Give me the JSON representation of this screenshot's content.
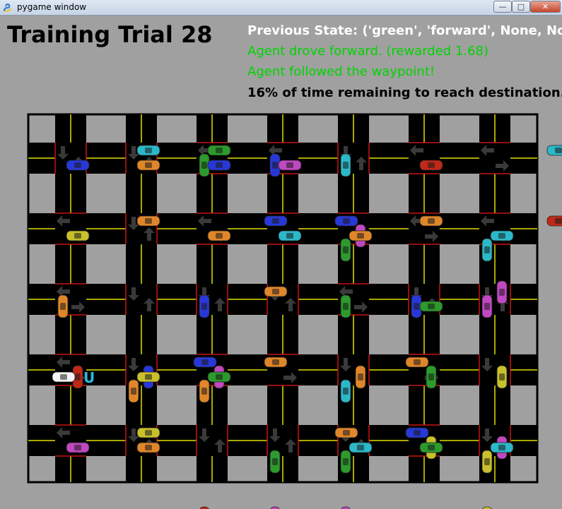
{
  "window": {
    "title": "pygame window",
    "controls": {
      "minimize": "—",
      "maximize": "□",
      "close": "✕"
    },
    "icon": "pygame-snake-icon"
  },
  "hud": {
    "title": "Training Trial 28",
    "previous_state": "Previous State: ('green', 'forward', None, None",
    "action_result": "Agent drove forward. (rewarded 1.68)",
    "waypoint_status": "Agent followed the waypoint!",
    "time_remaining": "16% of time remaining to reach destination."
  },
  "colors": {
    "background": "#a0a0a0",
    "road": "#000000",
    "lane_line": "#e0e000",
    "signal_red": "#c81414",
    "signal_green": "#00c800",
    "text_green": "#00d400",
    "text_white": "#ffffff"
  },
  "grid": {
    "columns": 7,
    "rows": 5,
    "lights": [
      "ns",
      "ns",
      "ew",
      "ew",
      "ns",
      "ew",
      "ew",
      "ew",
      "ns",
      "ew",
      "ew",
      "ew",
      "ew",
      "ew",
      "ew",
      "ns",
      "ns",
      "ns",
      "ew",
      "ns",
      "ns",
      "ew",
      "ns",
      "ew",
      "ew",
      "ns",
      "ew",
      "ns",
      "ew",
      "ns",
      "ns",
      "ns",
      "ns",
      "ew",
      "ns"
    ]
  },
  "cars": [
    {
      "color": "green",
      "dir": "v",
      "col": 2,
      "row": -0.4
    },
    {
      "color": "blue",
      "dir": "v",
      "col": 3,
      "row": -0.4
    },
    {
      "color": "cyan",
      "dir": "v",
      "col": 4,
      "row": -0.4
    },
    {
      "color": "cyan",
      "dir": "h",
      "row": 0,
      "col": 0.6
    },
    {
      "color": "green",
      "dir": "h",
      "row": 0,
      "col": 1.6
    },
    {
      "color": "blue",
      "dir": "h",
      "row": 0.2,
      "col": -0.4
    },
    {
      "color": "orange",
      "dir": "h",
      "row": 0.2,
      "col": 0.6
    },
    {
      "color": "blue",
      "dir": "h",
      "row": 0.2,
      "col": 1.6
    },
    {
      "color": "magenta",
      "dir": "h",
      "row": 0.2,
      "col": 2.6
    },
    {
      "color": "red",
      "dir": "h",
      "row": 0.2,
      "col": 4.6
    },
    {
      "color": "cyan",
      "dir": "h",
      "row": 0,
      "col": 6.4
    },
    {
      "color": "magenta",
      "dir": "v",
      "col": 4.2,
      "row": 0.6
    },
    {
      "color": "green",
      "dir": "v",
      "col": 4,
      "row": 0.8
    },
    {
      "color": "cyan",
      "dir": "v",
      "col": 6,
      "row": 0.8
    },
    {
      "color": "orange",
      "dir": "h",
      "row": 1,
      "col": 0.6
    },
    {
      "color": "blue",
      "dir": "h",
      "row": 1,
      "col": 2.4
    },
    {
      "color": "blue",
      "dir": "h",
      "row": 1,
      "col": 3.4
    },
    {
      "color": "orange",
      "dir": "h",
      "row": 1,
      "col": 4.6
    },
    {
      "color": "red",
      "dir": "h",
      "row": 1,
      "col": 6.4
    },
    {
      "color": "yellow",
      "dir": "h",
      "row": 1.2,
      "col": -0.4
    },
    {
      "color": "orange",
      "dir": "h",
      "row": 1.2,
      "col": 1.6
    },
    {
      "color": "cyan",
      "dir": "h",
      "row": 1.2,
      "col": 2.6
    },
    {
      "color": "orange",
      "dir": "h",
      "row": 1.2,
      "col": 3.6
    },
    {
      "color": "cyan",
      "dir": "h",
      "row": 1.2,
      "col": 5.6
    },
    {
      "color": "orange",
      "dir": "v",
      "col": 0,
      "row": 1.6
    },
    {
      "color": "blue",
      "dir": "v",
      "col": 2,
      "row": 1.6
    },
    {
      "color": "green",
      "dir": "v",
      "col": 4,
      "row": 1.6
    },
    {
      "color": "blue",
      "dir": "v",
      "col": 5,
      "row": 1.6
    },
    {
      "color": "magenta",
      "dir": "v",
      "col": 6,
      "row": 1.6
    },
    {
      "color": "magenta",
      "dir": "v",
      "col": 6.2,
      "row": 1.4
    },
    {
      "color": "orange",
      "dir": "h",
      "row": 2,
      "col": 2.4
    },
    {
      "color": "green",
      "dir": "h",
      "row": 2.2,
      "col": 4.6
    },
    {
      "color": "red",
      "dir": "v",
      "col": 0.2,
      "row": 2.6
    },
    {
      "color": "blue",
      "dir": "v",
      "col": 1.2,
      "row": 2.6
    },
    {
      "color": "orange",
      "dir": "v",
      "col": 1,
      "row": 2.8
    },
    {
      "color": "magenta",
      "dir": "v",
      "col": 2.2,
      "row": 2.6
    },
    {
      "color": "orange",
      "dir": "v",
      "col": 2,
      "row": 2.8
    },
    {
      "color": "orange",
      "dir": "v",
      "col": 4.2,
      "row": 2.6
    },
    {
      "color": "cyan",
      "dir": "v",
      "col": 4,
      "row": 2.8
    },
    {
      "color": "green",
      "dir": "v",
      "col": 5.2,
      "row": 2.6
    },
    {
      "color": "yellow",
      "dir": "v",
      "col": 6.2,
      "row": 2.6
    },
    {
      "color": "yellow",
      "dir": "h",
      "row": 3.2,
      "col": 0.6
    },
    {
      "color": "blue",
      "dir": "h",
      "row": 3,
      "col": 1.4
    },
    {
      "color": "green",
      "dir": "h",
      "row": 3.2,
      "col": 1.6
    },
    {
      "color": "orange",
      "dir": "h",
      "row": 3,
      "col": 2.4
    },
    {
      "color": "orange",
      "dir": "h",
      "row": 3,
      "col": 4.4
    },
    {
      "color": "yellow",
      "dir": "v",
      "col": 5.2,
      "row": 3.6
    },
    {
      "color": "magenta",
      "dir": "v",
      "col": 6.2,
      "row": 3.6
    },
    {
      "color": "green",
      "dir": "v",
      "col": 3,
      "row": 3.8
    },
    {
      "color": "green",
      "dir": "v",
      "col": 4,
      "row": 3.8
    },
    {
      "color": "yellow",
      "dir": "v",
      "col": 6,
      "row": 3.8
    },
    {
      "color": "yellow",
      "dir": "h",
      "row": 4,
      "col": 0.6
    },
    {
      "color": "orange",
      "dir": "h",
      "row": 4,
      "col": 3.4
    },
    {
      "color": "blue",
      "dir": "h",
      "row": 4,
      "col": 4.4
    },
    {
      "color": "magenta",
      "dir": "h",
      "row": 4.2,
      "col": -0.4
    },
    {
      "color": "orange",
      "dir": "h",
      "row": 4.2,
      "col": 0.6
    },
    {
      "color": "cyan",
      "dir": "h",
      "row": 4.2,
      "col": 3.6
    },
    {
      "color": "green",
      "dir": "h",
      "row": 4.2,
      "col": 4.6
    },
    {
      "color": "cyan",
      "dir": "h",
      "row": 4.2,
      "col": 5.6
    },
    {
      "color": "red",
      "dir": "v",
      "col": 2,
      "row": 4.6
    },
    {
      "color": "magenta",
      "dir": "v",
      "col": 3,
      "row": 4.6
    },
    {
      "color": "magenta",
      "dir": "v",
      "col": 4,
      "row": 4.6
    },
    {
      "color": "yellow",
      "dir": "v",
      "col": 6,
      "row": 4.6
    }
  ],
  "agent": {
    "color": "white",
    "dir": "h",
    "row": 3.2,
    "col": -0.6,
    "logo": "udacity-logo"
  },
  "car_palette": {
    "green": "#2c9a2c",
    "blue": "#2838d8",
    "cyan": "#2cb8c8",
    "orange": "#e0862a",
    "magenta": "#c048c0",
    "red": "#c02818",
    "yellow": "#c8c02c",
    "white": "#f4f4f4"
  }
}
